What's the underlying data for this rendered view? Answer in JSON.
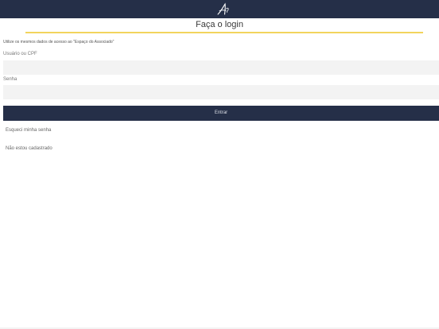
{
  "header": {
    "logo_icon": "brand-logo-icon",
    "background_color": "#252f48"
  },
  "title": "Faça o login",
  "accent_color": "#f2d45c",
  "hint": "Utilize os mesmos dados de acesso ao \"Espaço do Associado\"",
  "form": {
    "username_label": "Usuário ou CPF",
    "username_value": "",
    "password_label": "Senha",
    "password_value": "",
    "submit_label": "Entrar"
  },
  "links": {
    "forgot_password": "Esqueci minha senha",
    "not_registered": "Não estou cadastrado"
  }
}
